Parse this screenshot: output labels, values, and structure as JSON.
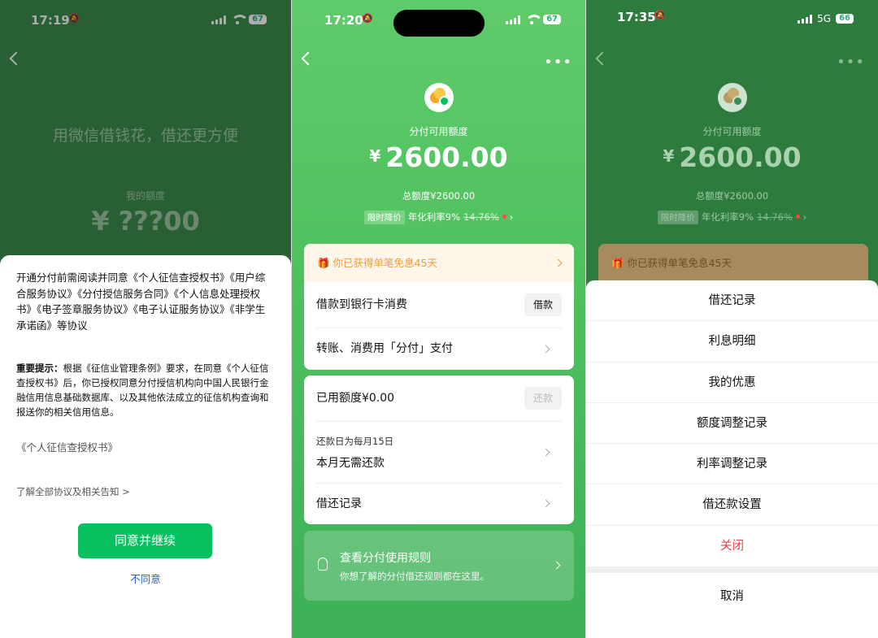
{
  "status1": {
    "time": "17:19",
    "battery": "67"
  },
  "status2": {
    "time": "17:20",
    "battery": "67"
  },
  "status3": {
    "time": "17:35",
    "network": "5G",
    "battery": "66"
  },
  "panel1": {
    "bg_title": "用微信借钱花，借还更方便",
    "bg_label": "我的额度",
    "bg_amount": "¥ ???00",
    "intro": "开通分付前需阅读并同意《个人征信查授权书》《用户综合服务协议》《分付授信服务合同》《个人信息处理授权书》《电子签章服务协议》《电子认证服务协议》《非学生承诺函》等协议",
    "notice_label": "重要提示：",
    "notice": "根据《征信业管理条例》要求，在同意《个人征信查授权书》后，你已授权同意分付授信机构向中国人民银行金融信用信息基础数据库、以及其他依法成立的征信机构查询和报送你的相关信用信息。",
    "doc_link": "《个人征信查授权书》",
    "all_link": "了解全部协议及相关告知 >",
    "agree": "同意并继续",
    "disagree": "不同意"
  },
  "main": {
    "avail_label": "分付可用额度",
    "currency": "¥",
    "amount": "2600.00",
    "total": "总额度¥2600.00",
    "rate_tag": "限时降价",
    "rate_text": "年化利率9%",
    "rate_old": "14.76%",
    "promo": "你已获得单笔免息45天",
    "row_bank": "借款到银行卡消费",
    "btn_borrow": "借款",
    "row_transfer": "转账、消费用「分付」支付",
    "used": "已用额度¥0.00",
    "btn_repay": "还款",
    "repay_day": "还款日为每月15日",
    "no_repay": "本月无需还款",
    "records": "借还记录",
    "rules_title": "查看分付使用规则",
    "rules_sub": "你想了解的分付借还规则都在这里。"
  },
  "menu": {
    "items": [
      "借还记录",
      "利息明细",
      "我的优惠",
      "额度调整记录",
      "利率调整记录",
      "借还款设置"
    ],
    "close": "关闭",
    "cancel": "取消"
  },
  "colors": {
    "brand_green": "#07c160",
    "link_blue": "#2e5db5",
    "danger_red": "#e64340",
    "promo_orange": "#f29b38"
  }
}
